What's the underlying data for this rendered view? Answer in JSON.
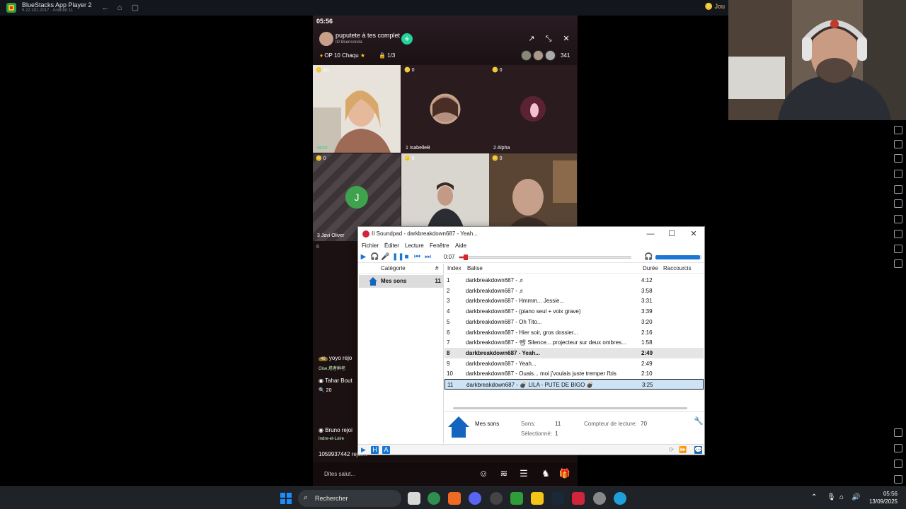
{
  "bluestacks": {
    "title": "BlueStacks App Player 2",
    "version": "5.22.101.2017 · Android 11",
    "right_label": "Jou"
  },
  "phone": {
    "status_time": "05:56",
    "room_title": "puputete à tes complet",
    "room_id": "ID:lilsencorela",
    "ticker": "OP 10 Chaqu",
    "seat_count": "1/3",
    "viewers": "341",
    "tiles": [
      {
        "badge": "10",
        "name": "Host"
      },
      {
        "badge": "0",
        "name": "1  IsabelleB"
      },
      {
        "badge": "0",
        "name": "2  Alpha"
      },
      {
        "badge": "0",
        "name": "3  Javi Oliver",
        "initial": "J"
      },
      {
        "badge": "0",
        "name": ""
      },
      {
        "badge": "0",
        "name": ""
      }
    ],
    "side_num": "6",
    "chat": [
      "yoyo rejo",
      "Oise,塔者鲜老",
      "Tahar Bout",
      "20",
      "Bruno rejoi",
      "Indre-et-Loire",
      "1059937442 rejoint"
    ],
    "say_hi": "Dites salut..."
  },
  "soundpad": {
    "title": "II  Soundpad - darkbreakdown687 - Yeah...",
    "menu": [
      "Fichier",
      "Éditer",
      "Lecture",
      "Fenêtre",
      "Aide"
    ],
    "time": "0:07",
    "seek_fraction": 0.03,
    "volume_fraction": 0.95,
    "category_header": "Catégorie",
    "category_hash": "#",
    "category": {
      "name": "Mes sons",
      "count": "11"
    },
    "columns": {
      "index": "Index",
      "tag": "Balise",
      "duration": "Durée",
      "shortcuts": "Raccourcis"
    },
    "rows": [
      {
        "index": "1",
        "tag": "darkbreakdown687 - ♬",
        "duration": "4:12"
      },
      {
        "index": "2",
        "tag": "darkbreakdown687 - ♬",
        "duration": "3:58"
      },
      {
        "index": "3",
        "tag": "darkbreakdown687 - Hmmm... Jessie...",
        "duration": "3:31"
      },
      {
        "index": "4",
        "tag": "darkbreakdown687 - (piano seul + voix grave)",
        "duration": "3:39"
      },
      {
        "index": "5",
        "tag": "darkbreakdown687 - Oh Tito...",
        "duration": "3:20"
      },
      {
        "index": "6",
        "tag": "darkbreakdown687 - Hier soir, gros dossier...",
        "duration": "2:16"
      },
      {
        "index": "7",
        "tag": "darkbreakdown687 - 📽 Silence... projecteur sur deux ombres...",
        "duration": "1:58"
      },
      {
        "index": "8",
        "tag": "darkbreakdown687 - Yeah...",
        "duration": "2:49"
      },
      {
        "index": "9",
        "tag": "darkbreakdown687 - Yeah...",
        "duration": "2:49"
      },
      {
        "index": "10",
        "tag": "darkbreakdown687 - Ouais... moi j'voulais juste tremper l'bis",
        "duration": "2:10"
      },
      {
        "index": "11",
        "tag": "darkbreakdown687 - 💣 LILA - PUTE DE BIGO 💣",
        "duration": "3:25"
      }
    ],
    "info": {
      "name": "Mes sons",
      "sons_label": "Sons:",
      "sons_value": "11",
      "selected_label": "Sélectionné:",
      "selected_value": "1",
      "counter_label": "Compteur de lecture:",
      "counter_value": "70"
    }
  },
  "taskbar": {
    "search": "Rechercher",
    "time": "05:56",
    "date": "13/09/2025"
  },
  "colors": {
    "accent": "#1976d2",
    "seek": "#d9252a",
    "selected_row": "#cde4f7"
  }
}
